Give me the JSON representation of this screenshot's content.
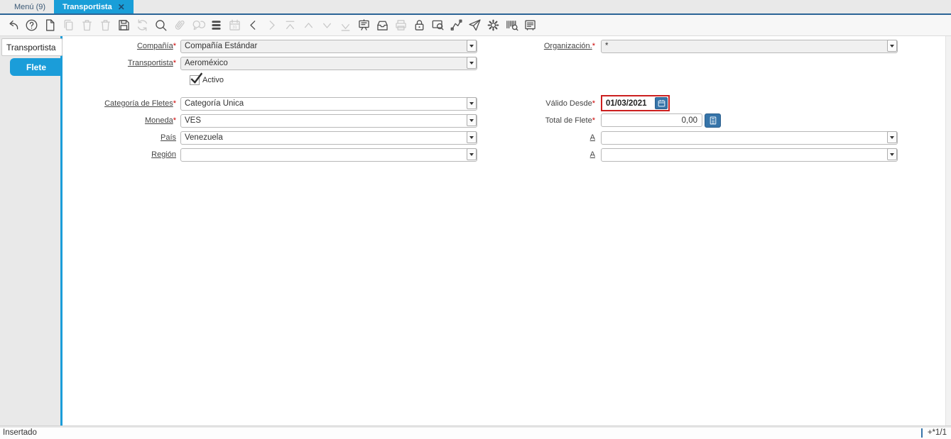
{
  "window": {
    "tabs": [
      {
        "label": "Menú (9)",
        "active": false
      },
      {
        "label": "Transportista",
        "active": true
      }
    ],
    "close_glyph": "✕"
  },
  "toolbar": {
    "icons": [
      {
        "name": "undo-icon",
        "enabled": true
      },
      {
        "name": "help-icon",
        "enabled": true
      },
      {
        "name": "new-record-icon",
        "enabled": true
      },
      {
        "name": "copy-record-icon",
        "enabled": false
      },
      {
        "name": "delete-record-icon",
        "enabled": false
      },
      {
        "name": "delete-selection-icon",
        "enabled": false
      },
      {
        "name": "save-icon",
        "enabled": true
      },
      {
        "name": "refresh-icon",
        "enabled": false
      },
      {
        "name": "find-icon",
        "enabled": true
      },
      {
        "name": "attachment-icon",
        "enabled": false
      },
      {
        "name": "chat-icon",
        "enabled": false
      },
      {
        "name": "grid-toggle-icon",
        "enabled": true
      },
      {
        "name": "calendar-icon",
        "enabled": false
      },
      {
        "name": "parent-record-icon",
        "enabled": true
      },
      {
        "name": "detail-record-icon",
        "enabled": false
      },
      {
        "name": "first-record-icon",
        "enabled": false
      },
      {
        "name": "previous-record-icon",
        "enabled": false
      },
      {
        "name": "next-record-icon",
        "enabled": false
      },
      {
        "name": "last-record-icon",
        "enabled": false
      },
      {
        "name": "report-icon",
        "enabled": true
      },
      {
        "name": "archive-icon",
        "enabled": true
      },
      {
        "name": "print-icon",
        "enabled": false
      },
      {
        "name": "lock-icon",
        "enabled": true
      },
      {
        "name": "zoom-across-icon",
        "enabled": true
      },
      {
        "name": "workflow-icon",
        "enabled": true
      },
      {
        "name": "request-icon",
        "enabled": true
      },
      {
        "name": "preference-icon",
        "enabled": true
      },
      {
        "name": "product-info-icon",
        "enabled": true
      },
      {
        "name": "form-icon",
        "enabled": true
      }
    ]
  },
  "sidebar": {
    "tabs": [
      {
        "label": "Transportista",
        "active": true
      },
      {
        "label": "Flete",
        "active": false
      }
    ]
  },
  "form": {
    "compania": {
      "label": "Compañía",
      "required": "*",
      "value": "Compañía Estándar"
    },
    "organizacion": {
      "label": "Organización.",
      "required": "*",
      "value": "*"
    },
    "transportista": {
      "label": "Transportista",
      "required": "*",
      "value": "Aeroméxico"
    },
    "activo": {
      "label": "Activo",
      "checked": true
    },
    "categoria_fletes": {
      "label": "Categoría de Fletes",
      "required": "*",
      "value": "Categoría Única"
    },
    "valido_desde": {
      "label": "Válido Desde",
      "required": "*",
      "value": "01/03/2021"
    },
    "moneda": {
      "label": "Moneda",
      "required": "*",
      "value": "VES"
    },
    "total_flete": {
      "label": "Total de Flete",
      "required": "*",
      "value": "0,00"
    },
    "pais": {
      "label": "País",
      "value": "Venezuela"
    },
    "a1": {
      "label": "A",
      "value": ""
    },
    "region": {
      "label": "Región",
      "value": ""
    },
    "a2": {
      "label": "A",
      "value": ""
    }
  },
  "statusbar": {
    "left": "Insertado",
    "right": "+*1/1"
  },
  "colors": {
    "accent_blue": "#1b9dd9",
    "tab_border_blue": "#2b6496",
    "button_blue": "#3674a9",
    "highlight_red": "#cc1f1f",
    "required_red": "#cc0000"
  }
}
